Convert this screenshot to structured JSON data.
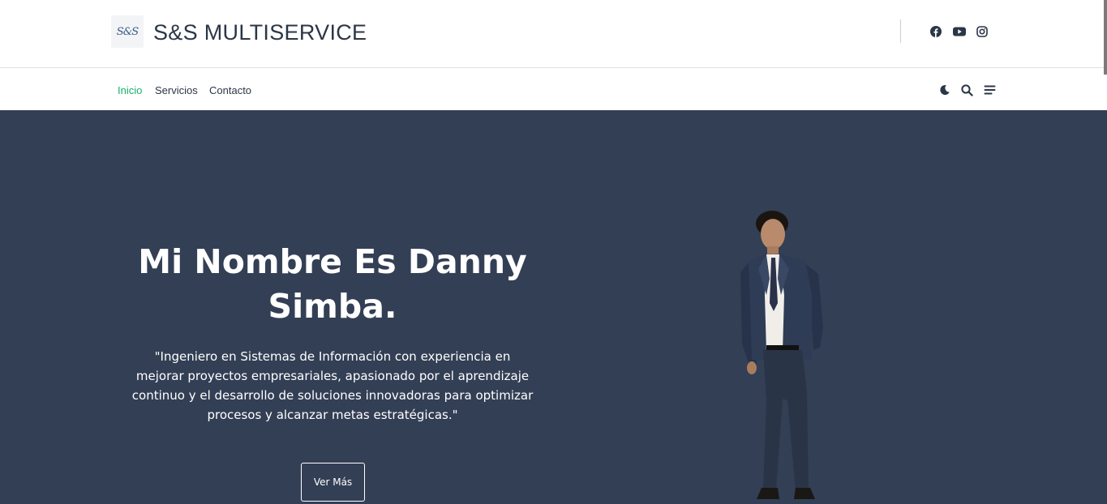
{
  "header": {
    "logo_text": "S&S",
    "site_title": "S&S MULTISERVICE",
    "social": [
      {
        "icon": "facebook-icon"
      },
      {
        "icon": "youtube-icon"
      },
      {
        "icon": "instagram-icon"
      }
    ]
  },
  "nav": {
    "items": [
      {
        "label": "Inicio",
        "active": true
      },
      {
        "label": "Servicios",
        "active": false
      },
      {
        "label": "Contacto",
        "active": false
      }
    ],
    "tools": [
      {
        "icon": "moon-icon"
      },
      {
        "icon": "search-icon"
      },
      {
        "icon": "menu-icon"
      }
    ]
  },
  "hero": {
    "title": "Mi Nombre Es Danny Simba.",
    "description": "\"Ingeniero en Sistemas de Información con experiencia en mejorar proyectos empresariales, apasionado por el aprendizaje continuo y el desarrollo de soluciones innovadoras para optimizar procesos y alcanzar metas estratégicas.\"",
    "button_label": "Ver Más",
    "image": "person-photo"
  },
  "colors": {
    "hero_bg": "#333f55",
    "accent": "#17b26a",
    "text_dark": "#2b3646"
  }
}
